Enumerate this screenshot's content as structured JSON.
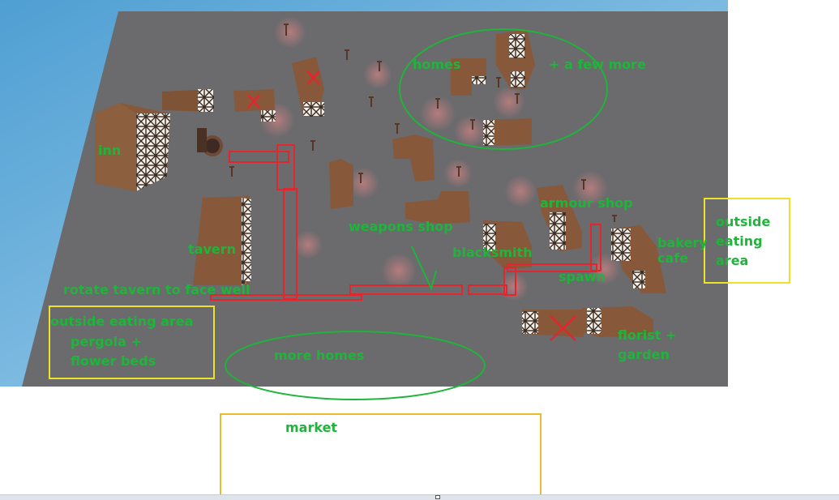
{
  "colors": {
    "sky": "#6cb1d9",
    "ground": "#6b6a6d",
    "building_roof": "#8a5e3f",
    "building_dark": "#5c3a26",
    "annotation_green": "#1fb43a",
    "path_red": "#e3262d",
    "outline_yellow": "#ece22a"
  },
  "labels": {
    "homes": "homes",
    "a_few_more": "+ a few more",
    "inn": "inn",
    "armour_shop": "armour shop",
    "weapons_shop": "weapons shop",
    "blacksmith": "blacksmith",
    "tavern": "tavern",
    "bakery": "bakery",
    "cafe": "cafe",
    "spawn": "spawn",
    "rotate_tavern": "rotate tavern to face well",
    "outside_left_1": "outside eating area",
    "outside_left_2": "pergola +",
    "outside_left_3": "flower beds",
    "outside_right_1": "outside",
    "outside_right_2": "eating",
    "outside_right_3": "area",
    "more_homes": "more homes",
    "florist_1": "florist +",
    "florist_2": "garden",
    "market": "market"
  }
}
